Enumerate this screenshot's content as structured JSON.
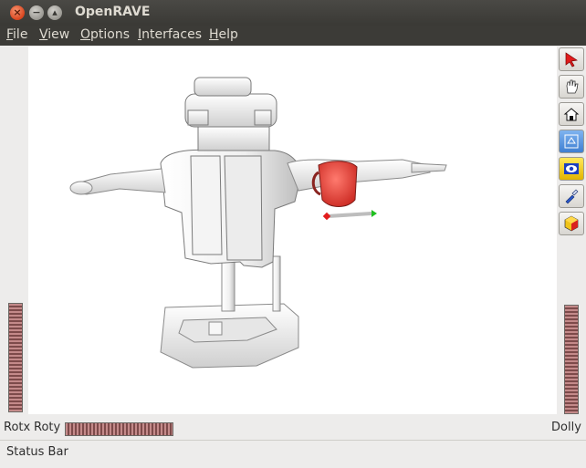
{
  "window": {
    "title": "OpenRAVE",
    "close_glyph": "×",
    "minimize_glyph": "−",
    "maximize_glyph": "▴"
  },
  "menu": [
    {
      "label": "File",
      "mnemonic": "F"
    },
    {
      "label": "View",
      "mnemonic": "V"
    },
    {
      "label": "Options",
      "mnemonic": "O"
    },
    {
      "label": "Interfaces",
      "mnemonic": "I"
    },
    {
      "label": "Help",
      "mnemonic": "H"
    }
  ],
  "toolbar": {
    "icons": [
      "select-arrow-icon",
      "hand-pan-icon",
      "home-icon",
      "view-all-icon",
      "eye-seek-icon",
      "flashlight-icon",
      "cube-projection-icon"
    ]
  },
  "controls": {
    "rotx_label": "Rotx",
    "roty_label": "Roty",
    "dolly_label": "Dolly"
  },
  "status": {
    "text": "Status Bar"
  },
  "colors": {
    "accent_red": "#e23b3b",
    "slider": "#8a5a5a"
  }
}
